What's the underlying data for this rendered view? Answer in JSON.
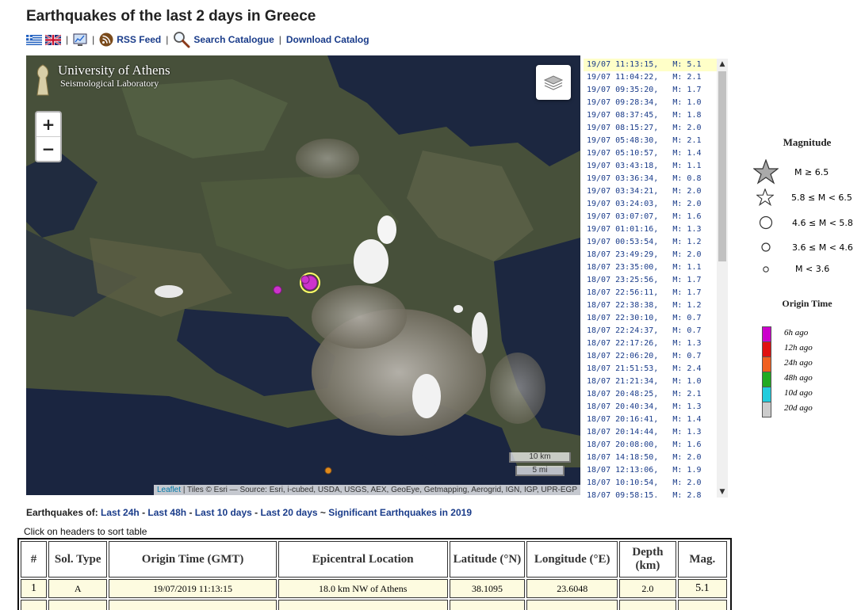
{
  "page": {
    "title": "Earthquakes of the last 2 days in Greece"
  },
  "toolbar": {
    "flag_gr_icon": "greek-flag-icon",
    "flag_uk_icon": "uk-flag-icon",
    "chart_icon": "monitor-chart-icon",
    "rss_icon": "rss-icon",
    "rss_label": "RSS Feed",
    "search_icon": "magnifier-icon",
    "search_label": "Search Catalogue",
    "download_label": "Download Catalog",
    "separator": "|"
  },
  "map": {
    "logo_name": "University of Athens",
    "logo_sub": "Seismological Laboratory",
    "zoom_in": "+",
    "zoom_out": "−",
    "scale_km": "10 km",
    "scale_mi": "5 mi",
    "attribution_leaflet": "Leaflet",
    "attribution_rest": "| Tiles © Esri — Source: Esri, i-cubed, USDA, USGS, AEX, GeoEye, Getmapping, Aerogrid, IGN, IGP, UPR-EGP",
    "colors": {
      "event_recent": "#cc33cc",
      "event_highlight": "#ffff66",
      "event_old": "#e08a1a"
    }
  },
  "events": [
    {
      "time": "19/07 11:13:15,",
      "mag": "M: 5.1"
    },
    {
      "time": "19/07 11:04:22,",
      "mag": "M: 2.1"
    },
    {
      "time": "19/07 09:35:20,",
      "mag": "M: 1.7"
    },
    {
      "time": "19/07 09:28:34,",
      "mag": "M: 1.0"
    },
    {
      "time": "19/07 08:37:45,",
      "mag": "M: 1.8"
    },
    {
      "time": "19/07 08:15:27,",
      "mag": "M: 2.0"
    },
    {
      "time": "19/07 05:48:30,",
      "mag": "M: 2.1"
    },
    {
      "time": "19/07 05:10:57,",
      "mag": "M: 1.4"
    },
    {
      "time": "19/07 03:43:18,",
      "mag": "M: 1.1"
    },
    {
      "time": "19/07 03:36:34,",
      "mag": "M: 0.8"
    },
    {
      "time": "19/07 03:34:21,",
      "mag": "M: 2.0"
    },
    {
      "time": "19/07 03:24:03,",
      "mag": "M: 2.0"
    },
    {
      "time": "19/07 03:07:07,",
      "mag": "M: 1.6"
    },
    {
      "time": "19/07 01:01:16,",
      "mag": "M: 1.3"
    },
    {
      "time": "19/07 00:53:54,",
      "mag": "M: 1.2"
    },
    {
      "time": "18/07 23:49:29,",
      "mag": "M: 2.0"
    },
    {
      "time": "18/07 23:35:00,",
      "mag": "M: 1.1"
    },
    {
      "time": "18/07 23:25:56,",
      "mag": "M: 1.7"
    },
    {
      "time": "18/07 22:56:11,",
      "mag": "M: 1.7"
    },
    {
      "time": "18/07 22:38:38,",
      "mag": "M: 1.2"
    },
    {
      "time": "18/07 22:30:10,",
      "mag": "M: 0.7"
    },
    {
      "time": "18/07 22:24:37,",
      "mag": "M: 0.7"
    },
    {
      "time": "18/07 22:17:26,",
      "mag": "M: 1.3"
    },
    {
      "time": "18/07 22:06:20,",
      "mag": "M: 0.7"
    },
    {
      "time": "18/07 21:51:53,",
      "mag": "M: 2.4"
    },
    {
      "time": "18/07 21:21:34,",
      "mag": "M: 1.0"
    },
    {
      "time": "18/07 20:48:25,",
      "mag": "M: 2.1"
    },
    {
      "time": "18/07 20:40:34,",
      "mag": "M: 1.3"
    },
    {
      "time": "18/07 20:16:41,",
      "mag": "M: 1.4"
    },
    {
      "time": "18/07 20:14:44,",
      "mag": "M: 1.3"
    },
    {
      "time": "18/07 20:08:00,",
      "mag": "M: 1.6"
    },
    {
      "time": "18/07 14:18:50,",
      "mag": "M: 2.0"
    },
    {
      "time": "18/07 12:13:06,",
      "mag": "M: 1.9"
    },
    {
      "time": "18/07 10:10:54,",
      "mag": "M: 2.0"
    },
    {
      "time": "18/07 09:58:15,",
      "mag": "M: 2.8"
    }
  ],
  "legend": {
    "magnitude_title": "Magnitude",
    "magnitude": [
      {
        "label": "M ≥ 6.5",
        "icon": "large-star-icon"
      },
      {
        "label": "5.8 ≤ M < 6.5",
        "icon": "star-icon"
      },
      {
        "label": "4.6 ≤ M < 5.8",
        "icon": "large-circle-icon"
      },
      {
        "label": "3.6 ≤ M < 4.6",
        "icon": "medium-circle-icon"
      },
      {
        "label": "M < 3.6",
        "icon": "small-circle-icon"
      }
    ],
    "time_title": "Origin Time",
    "time": [
      {
        "label": "6h ago",
        "color": "#cc00cc"
      },
      {
        "label": "12h ago",
        "color": "#e01010"
      },
      {
        "label": "24h ago",
        "color": "#f06020"
      },
      {
        "label": "48h ago",
        "color": "#22aa22"
      },
      {
        "label": "10d ago",
        "color": "#22ccdd"
      },
      {
        "label": "20d ago",
        "color": "#cccccc"
      }
    ]
  },
  "periods": {
    "prefix": "Earthquakes of:",
    "last24": "Last 24h",
    "last48": "Last 48h",
    "last10": "Last 10 days",
    "last20": "Last 20 days",
    "tilde": "~",
    "significant": "Significant Earthquakes in 2019",
    "dash": "-"
  },
  "table": {
    "hint": "Click on headers to sort table",
    "headers": [
      "#",
      "Sol. Type",
      "Origin Time (GMT)",
      "Epicentral Location",
      "Latitude (°N)",
      "Longitude (°E)",
      "Depth (km)",
      "Mag."
    ],
    "rows": [
      [
        "1",
        "A",
        "19/07/2019 11:13:15",
        "18.0 km NW of Athens",
        "38.1095",
        "23.6048",
        "2.0",
        "5.1"
      ]
    ]
  }
}
